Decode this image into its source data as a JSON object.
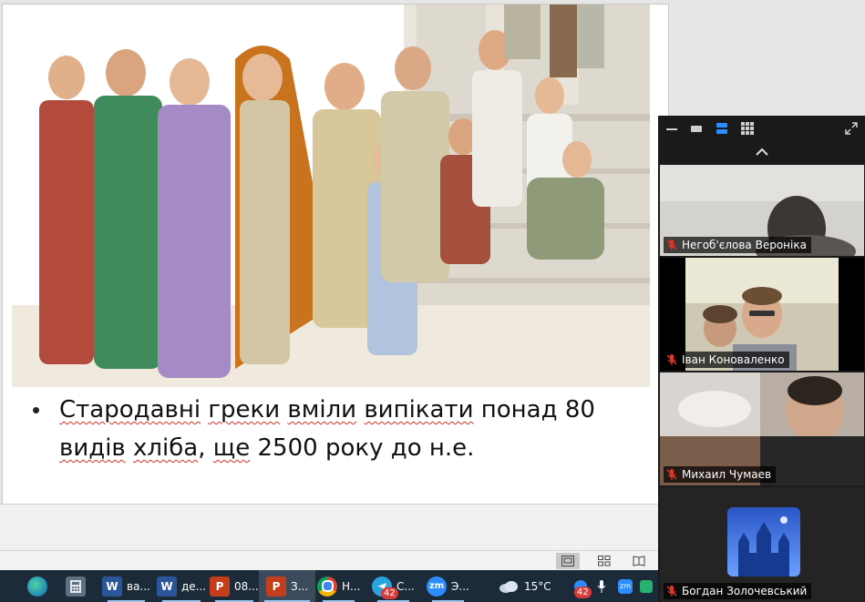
{
  "slide": {
    "bullet_text_parts": [
      "Стародавні",
      "греки",
      "вміли",
      "випікати",
      "понад 80",
      "видів",
      "хліба",
      ", ",
      "ще",
      "2500 року до н.е."
    ],
    "illustration_icon": "ancient-greek-people-illustration"
  },
  "statusbar": {
    "views": [
      "normal-view-icon",
      "slide-sorter-icon",
      "reading-view-icon"
    ]
  },
  "zoom": {
    "toolbar_icons": [
      "minimize-icon",
      "speaker-view-icon",
      "gallery-strip-icon",
      "gallery-grid-icon",
      "exit-fullscreen-icon"
    ],
    "participants": [
      {
        "name": "Негоб'єлова Вероніка",
        "muted": true
      },
      {
        "name": "Іван Коноваленко",
        "muted": true
      },
      {
        "name": "Михаил Чумаев",
        "muted": true
      },
      {
        "name": "Богдан Золочевський",
        "muted": true
      }
    ]
  },
  "taskbar": {
    "items": [
      {
        "icon": "edge-icon",
        "label": ""
      },
      {
        "icon": "calculator-icon",
        "label": ""
      },
      {
        "icon": "word-icon",
        "label": "ва..."
      },
      {
        "icon": "word-icon",
        "label": "де..."
      },
      {
        "icon": "powerpoint-icon",
        "label": "08..."
      },
      {
        "icon": "powerpoint-icon",
        "label": "З..."
      },
      {
        "icon": "chrome-icon",
        "label": "Н..."
      },
      {
        "icon": "telegram-icon",
        "label": "С...",
        "badge": "42"
      },
      {
        "icon": "zoom-icon",
        "label": "Э..."
      }
    ],
    "weather": {
      "temp": "15°C"
    },
    "tray_badge": "42"
  },
  "colors": {
    "taskbar": "#1c2b3a",
    "zoom_bg": "#1a1a1a",
    "mute_red": "#e0352b",
    "tile_active_border": "#2d8cff"
  }
}
